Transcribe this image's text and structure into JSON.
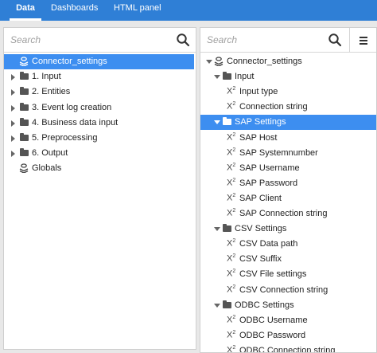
{
  "tabs": [
    {
      "label": "Data",
      "active": true
    },
    {
      "label": "Dashboards",
      "active": false
    },
    {
      "label": "HTML panel",
      "active": false
    }
  ],
  "left": {
    "search_placeholder": "Search",
    "tree": [
      {
        "label": "Connector_settings",
        "icon": "connector-icon",
        "selected": true
      },
      {
        "label": "1. Input",
        "icon": "folder-icon",
        "expanded": false
      },
      {
        "label": "2. Entities",
        "icon": "folder-icon",
        "expanded": false
      },
      {
        "label": "3. Event log creation",
        "icon": "folder-icon",
        "expanded": false
      },
      {
        "label": "4. Business data input",
        "icon": "folder-icon",
        "expanded": false
      },
      {
        "label": "5. Preprocessing",
        "icon": "folder-icon",
        "expanded": false
      },
      {
        "label": "6. Output",
        "icon": "folder-icon",
        "expanded": false
      },
      {
        "label": "Globals",
        "icon": "globals-icon"
      }
    ]
  },
  "right": {
    "search_placeholder": "Search",
    "tree": [
      {
        "label": "Connector_settings",
        "icon": "connector-icon",
        "expanded": true
      },
      {
        "label": "Input",
        "icon": "folder-icon",
        "expanded": true
      },
      {
        "label": "Input type",
        "icon": "variable-icon"
      },
      {
        "label": "Connection string",
        "icon": "variable-icon"
      },
      {
        "label": "SAP Settings",
        "icon": "folder-icon",
        "expanded": true,
        "selected": true
      },
      {
        "label": "SAP Host",
        "icon": "variable-icon"
      },
      {
        "label": "SAP Systemnumber",
        "icon": "variable-icon"
      },
      {
        "label": "SAP Username",
        "icon": "variable-icon"
      },
      {
        "label": "SAP Password",
        "icon": "variable-icon"
      },
      {
        "label": "SAP Client",
        "icon": "variable-icon"
      },
      {
        "label": "SAP Connection string",
        "icon": "variable-icon"
      },
      {
        "label": "CSV Settings",
        "icon": "folder-icon",
        "expanded": true
      },
      {
        "label": "CSV Data path",
        "icon": "variable-icon"
      },
      {
        "label": "CSV Suffix",
        "icon": "variable-icon"
      },
      {
        "label": "CSV File settings",
        "icon": "variable-icon"
      },
      {
        "label": "CSV Connection string",
        "icon": "variable-icon"
      },
      {
        "label": "ODBC Settings",
        "icon": "folder-icon",
        "expanded": true
      },
      {
        "label": "ODBC Username",
        "icon": "variable-icon"
      },
      {
        "label": "ODBC Password",
        "icon": "variable-icon"
      },
      {
        "label": "ODBC Connection string",
        "icon": "variable-icon"
      }
    ]
  },
  "variable_icon_glyph": "X",
  "variable_icon_sup": "2",
  "colors": {
    "accent": "#2f7fd6",
    "selection": "#3d8ef0"
  }
}
